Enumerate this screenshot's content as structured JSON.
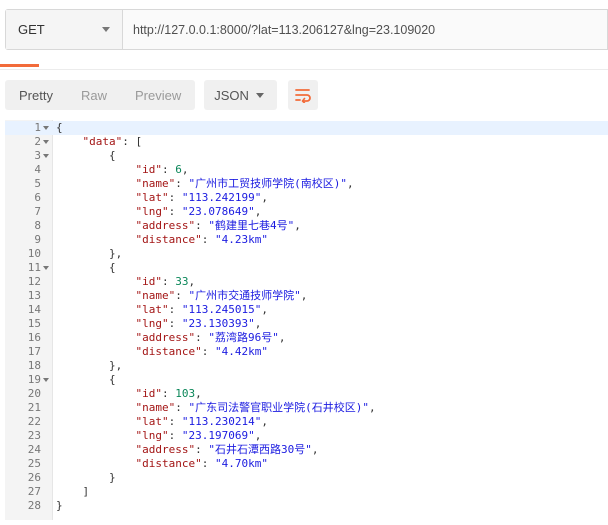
{
  "request": {
    "method": "GET",
    "url": "http://127.0.0.1:8000/?lat=113.206127&lng=23.109020"
  },
  "response_toolbar": {
    "views": [
      "Pretty",
      "Raw",
      "Preview"
    ],
    "active_view": "Pretty",
    "format": "JSON",
    "wrap_icon": "wrap-lines-icon"
  },
  "colors": {
    "accent": "#f26b3a",
    "json_key": "#a31515",
    "json_string": "#1b1be0",
    "json_number": "#098658"
  },
  "code_lines": [
    {
      "ln": "1",
      "fold": true,
      "indent": 0,
      "parts": [
        [
          "p",
          "{"
        ]
      ]
    },
    {
      "ln": "2",
      "fold": true,
      "indent": 1,
      "parts": [
        [
          "k",
          "\"data\""
        ],
        [
          "p",
          ": ["
        ]
      ]
    },
    {
      "ln": "3",
      "fold": true,
      "indent": 2,
      "parts": [
        [
          "p",
          "{"
        ]
      ]
    },
    {
      "ln": "4",
      "fold": false,
      "indent": 3,
      "parts": [
        [
          "k",
          "\"id\""
        ],
        [
          "p",
          ": "
        ],
        [
          "n",
          "6"
        ],
        [
          "p",
          ","
        ]
      ]
    },
    {
      "ln": "5",
      "fold": false,
      "indent": 3,
      "parts": [
        [
          "k",
          "\"name\""
        ],
        [
          "p",
          ": "
        ],
        [
          "s",
          "\"广州市工贸技师学院(南校区)\""
        ],
        [
          "p",
          ","
        ]
      ]
    },
    {
      "ln": "6",
      "fold": false,
      "indent": 3,
      "parts": [
        [
          "k",
          "\"lat\""
        ],
        [
          "p",
          ": "
        ],
        [
          "s",
          "\"113.242199\""
        ],
        [
          "p",
          ","
        ]
      ]
    },
    {
      "ln": "7",
      "fold": false,
      "indent": 3,
      "parts": [
        [
          "k",
          "\"lng\""
        ],
        [
          "p",
          ": "
        ],
        [
          "s",
          "\"23.078649\""
        ],
        [
          "p",
          ","
        ]
      ]
    },
    {
      "ln": "8",
      "fold": false,
      "indent": 3,
      "parts": [
        [
          "k",
          "\"address\""
        ],
        [
          "p",
          ": "
        ],
        [
          "s",
          "\"鹤建里七巷4号\""
        ],
        [
          "p",
          ","
        ]
      ]
    },
    {
      "ln": "9",
      "fold": false,
      "indent": 3,
      "parts": [
        [
          "k",
          "\"distance\""
        ],
        [
          "p",
          ": "
        ],
        [
          "s",
          "\"4.23km\""
        ]
      ]
    },
    {
      "ln": "10",
      "fold": false,
      "indent": 2,
      "parts": [
        [
          "p",
          "},"
        ]
      ]
    },
    {
      "ln": "11",
      "fold": true,
      "indent": 2,
      "parts": [
        [
          "p",
          "{"
        ]
      ]
    },
    {
      "ln": "12",
      "fold": false,
      "indent": 3,
      "parts": [
        [
          "k",
          "\"id\""
        ],
        [
          "p",
          ": "
        ],
        [
          "n",
          "33"
        ],
        [
          "p",
          ","
        ]
      ]
    },
    {
      "ln": "13",
      "fold": false,
      "indent": 3,
      "parts": [
        [
          "k",
          "\"name\""
        ],
        [
          "p",
          ": "
        ],
        [
          "s",
          "\"广州市交通技师学院\""
        ],
        [
          "p",
          ","
        ]
      ]
    },
    {
      "ln": "14",
      "fold": false,
      "indent": 3,
      "parts": [
        [
          "k",
          "\"lat\""
        ],
        [
          "p",
          ": "
        ],
        [
          "s",
          "\"113.245015\""
        ],
        [
          "p",
          ","
        ]
      ]
    },
    {
      "ln": "15",
      "fold": false,
      "indent": 3,
      "parts": [
        [
          "k",
          "\"lng\""
        ],
        [
          "p",
          ": "
        ],
        [
          "s",
          "\"23.130393\""
        ],
        [
          "p",
          ","
        ]
      ]
    },
    {
      "ln": "16",
      "fold": false,
      "indent": 3,
      "parts": [
        [
          "k",
          "\"address\""
        ],
        [
          "p",
          ": "
        ],
        [
          "s",
          "\"荔湾路96号\""
        ],
        [
          "p",
          ","
        ]
      ]
    },
    {
      "ln": "17",
      "fold": false,
      "indent": 3,
      "parts": [
        [
          "k",
          "\"distance\""
        ],
        [
          "p",
          ": "
        ],
        [
          "s",
          "\"4.42km\""
        ]
      ]
    },
    {
      "ln": "18",
      "fold": false,
      "indent": 2,
      "parts": [
        [
          "p",
          "},"
        ]
      ]
    },
    {
      "ln": "19",
      "fold": true,
      "indent": 2,
      "parts": [
        [
          "p",
          "{"
        ]
      ]
    },
    {
      "ln": "20",
      "fold": false,
      "indent": 3,
      "parts": [
        [
          "k",
          "\"id\""
        ],
        [
          "p",
          ": "
        ],
        [
          "n",
          "103"
        ],
        [
          "p",
          ","
        ]
      ]
    },
    {
      "ln": "21",
      "fold": false,
      "indent": 3,
      "parts": [
        [
          "k",
          "\"name\""
        ],
        [
          "p",
          ": "
        ],
        [
          "s",
          "\"广东司法警官职业学院(石井校区)\""
        ],
        [
          "p",
          ","
        ]
      ]
    },
    {
      "ln": "22",
      "fold": false,
      "indent": 3,
      "parts": [
        [
          "k",
          "\"lat\""
        ],
        [
          "p",
          ": "
        ],
        [
          "s",
          "\"113.230214\""
        ],
        [
          "p",
          ","
        ]
      ]
    },
    {
      "ln": "23",
      "fold": false,
      "indent": 3,
      "parts": [
        [
          "k",
          "\"lng\""
        ],
        [
          "p",
          ": "
        ],
        [
          "s",
          "\"23.197069\""
        ],
        [
          "p",
          ","
        ]
      ]
    },
    {
      "ln": "24",
      "fold": false,
      "indent": 3,
      "parts": [
        [
          "k",
          "\"address\""
        ],
        [
          "p",
          ": "
        ],
        [
          "s",
          "\"石井石潭西路30号\""
        ],
        [
          "p",
          ","
        ]
      ]
    },
    {
      "ln": "25",
      "fold": false,
      "indent": 3,
      "parts": [
        [
          "k",
          "\"distance\""
        ],
        [
          "p",
          ": "
        ],
        [
          "s",
          "\"4.70km\""
        ]
      ]
    },
    {
      "ln": "26",
      "fold": false,
      "indent": 2,
      "parts": [
        [
          "p",
          "}"
        ]
      ]
    },
    {
      "ln": "27",
      "fold": false,
      "indent": 1,
      "parts": [
        [
          "p",
          "]"
        ]
      ]
    },
    {
      "ln": "28",
      "fold": false,
      "indent": 0,
      "parts": [
        [
          "p",
          "}"
        ]
      ]
    }
  ]
}
